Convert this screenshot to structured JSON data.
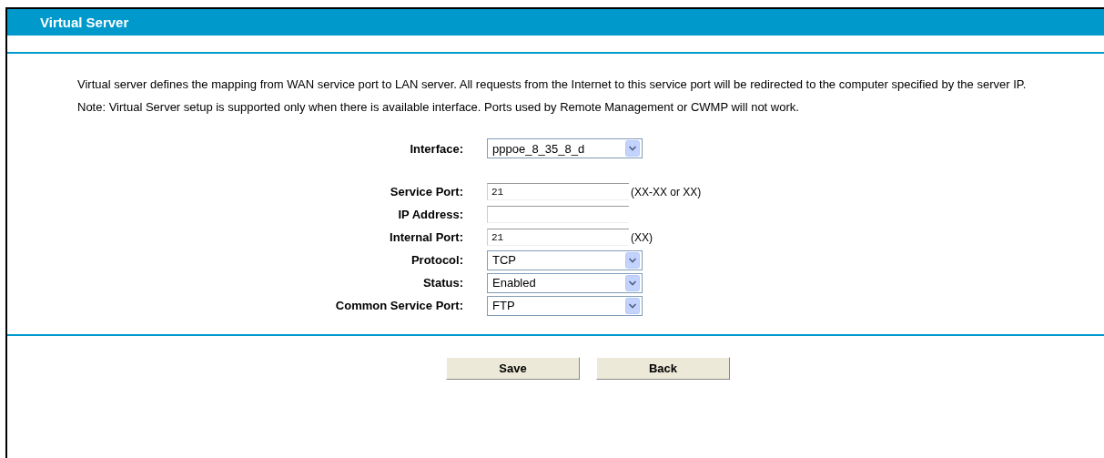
{
  "header": {
    "title": "Virtual Server"
  },
  "description": [
    "Virtual server defines the mapping from WAN service port to LAN server. All requests from the Internet to this service port will be redirected to the computer specified by the server IP.",
    "Note: Virtual Server setup is supported only when there is available interface. Ports used by Remote Management or CWMP will not work."
  ],
  "interface": {
    "label": "Interface:",
    "value": "pppoe_8_35_8_d"
  },
  "fields": [
    {
      "kind": "text",
      "label": "Service Port:",
      "value": "21",
      "hint": "(XX-XX or XX)"
    },
    {
      "kind": "text",
      "label": "IP Address:"
    },
    {
      "kind": "text",
      "label": "Internal Port:",
      "value": "21",
      "hint": "(XX)"
    },
    {
      "kind": "select",
      "label": "Protocol:",
      "value": "TCP"
    },
    {
      "kind": "select",
      "label": "Status:",
      "value": "Enabled"
    },
    {
      "kind": "select",
      "label": "Common Service Port:",
      "value": "FTP"
    }
  ],
  "buttons": [
    "Save",
    "Back"
  ]
}
